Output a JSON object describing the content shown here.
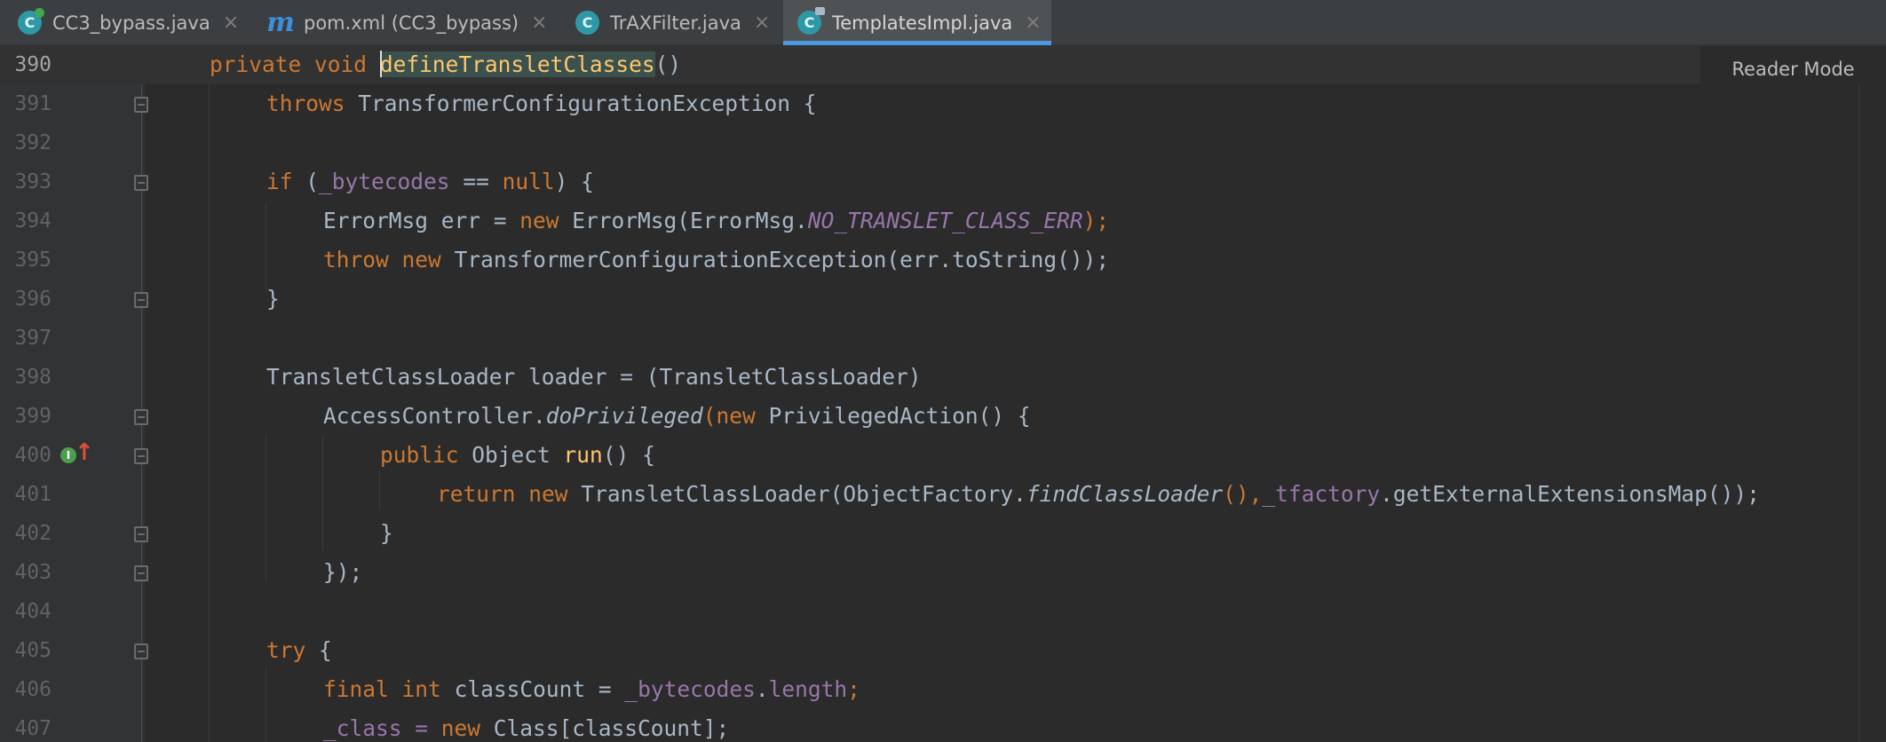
{
  "tabs": [
    {
      "label": "CC3_bypass.java",
      "icon": "java-class-run-icon",
      "active": false
    },
    {
      "label": "pom.xml (CC3_bypass)",
      "icon": "maven-icon",
      "active": false
    },
    {
      "label": "TrAXFilter.java",
      "icon": "java-class-icon",
      "active": false
    },
    {
      "label": "TemplatesImpl.java",
      "icon": "java-class-readonly-icon",
      "active": true
    }
  ],
  "tab_close_glyph": "×",
  "reader_mode": "Reader Mode",
  "line_numbers": [
    "390",
    "391",
    "392",
    "393",
    "394",
    "395",
    "396",
    "397",
    "398",
    "399",
    "400",
    "401",
    "402",
    "403",
    "404",
    "405",
    "406",
    "407"
  ],
  "code": {
    "l390": {
      "a": "private",
      "b": "void",
      "c": "defineTransletClasses",
      "d": "()"
    },
    "l391": {
      "a": "throws",
      "b": "TransformerConfigurationException {"
    },
    "l393": {
      "a": "if",
      "b": "(",
      "c": "_bytecodes",
      "d": " == ",
      "e": "null",
      "f": ") {"
    },
    "l394": {
      "a": "ErrorMsg err = ",
      "b": "new",
      "c": "ErrorMsg(ErrorMsg.",
      "d": "NO_TRANSLET_CLASS_ERR",
      "e": ");"
    },
    "l395": {
      "a": "throw",
      "b": "new",
      "c": "TransformerConfigurationException(err.toString());"
    },
    "l396": {
      "a": "}"
    },
    "l398": {
      "a": "TransletClassLoader loader = (TransletClassLoader)"
    },
    "l399": {
      "a": "AccessController.",
      "b": "doPrivileged",
      "c": "(",
      "d": "new",
      "e": "PrivilegedAction() {"
    },
    "l400": {
      "a": "public",
      "b": "Object ",
      "c": "run",
      "d": "() {"
    },
    "l401": {
      "a": "return",
      "b": "new",
      "c": "TransletClassLoader(ObjectFactory.",
      "d": "findClassLoader",
      "e": "(),",
      "f": "_tfactory",
      "g": ".getExternalExtensionsMap());"
    },
    "l402": {
      "a": "}"
    },
    "l403": {
      "a": "});"
    },
    "l405": {
      "a": "try",
      "b": " {"
    },
    "l406": {
      "a": "final",
      "b": "int",
      "c": "classCount = ",
      "d": "_bytecodes",
      "e": ".",
      "f": "length",
      "g": ";"
    },
    "l407": {
      "a": "_class = ",
      "b": "new",
      "c": "Class[classCount];"
    }
  },
  "colors": {
    "keyword": "#cc7832",
    "method_decl": "#ffc66d",
    "field": "#9876aa",
    "text": "#a9b7c6",
    "background": "#2b2b2b",
    "active_tab_underline": "#4a9ae0"
  }
}
